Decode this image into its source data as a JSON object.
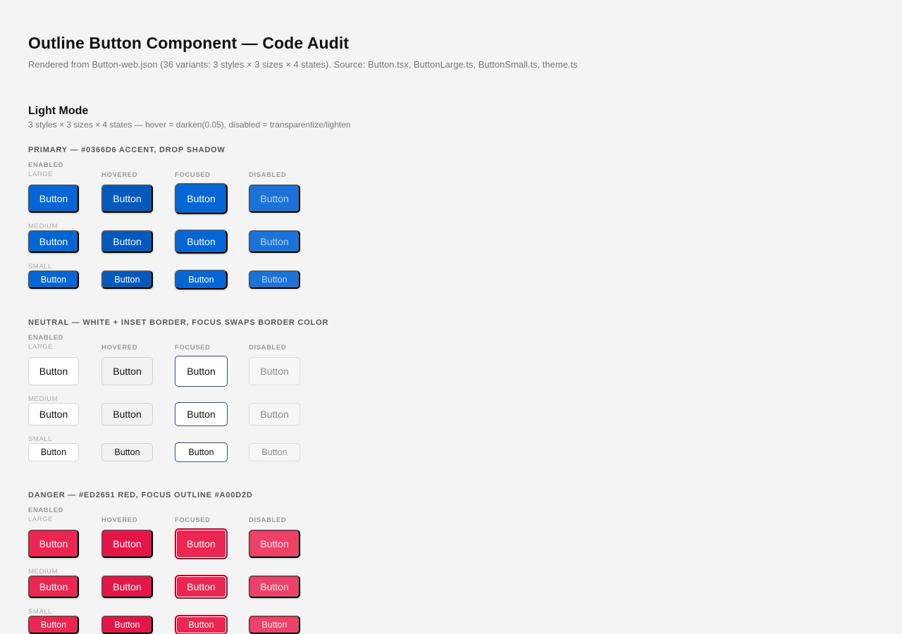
{
  "header": {
    "title": "Outline Button Component — Code Audit",
    "subtitle": "Rendered from Button-web.json (36 variants: 3 styles × 3 sizes × 4 states). Source: Button.tsx, ButtonLarge.ts, ButtonSmall.ts, theme.ts"
  },
  "mode": {
    "title": "Light Mode",
    "subtitle": "3 styles × 3 sizes × 4 states — hover = darken(0.05), disabled = transparentize/lighten"
  },
  "states": [
    "ENABLED",
    "HOVERED",
    "FOCUSED",
    "DISABLED"
  ],
  "sizes": [
    "LARGE",
    "MEDIUM",
    "SMALL"
  ],
  "button_label": "Button",
  "sections": [
    {
      "key": "primary",
      "title": "PRIMARY — #0366D6 ACCENT, DROP SHADOW"
    },
    {
      "key": "neutral",
      "title": "NEUTRAL — WHITE + INSET BORDER, FOCUS SWAPS BORDER COLOR"
    },
    {
      "key": "danger",
      "title": "DANGER — #ED2651 RED, FOCUS OUTLINE #A00D2D"
    }
  ],
  "colors": {
    "primary_accent": "#0366D6",
    "danger_red": "#ED2651",
    "danger_focus_outline": "#A00D2D"
  }
}
